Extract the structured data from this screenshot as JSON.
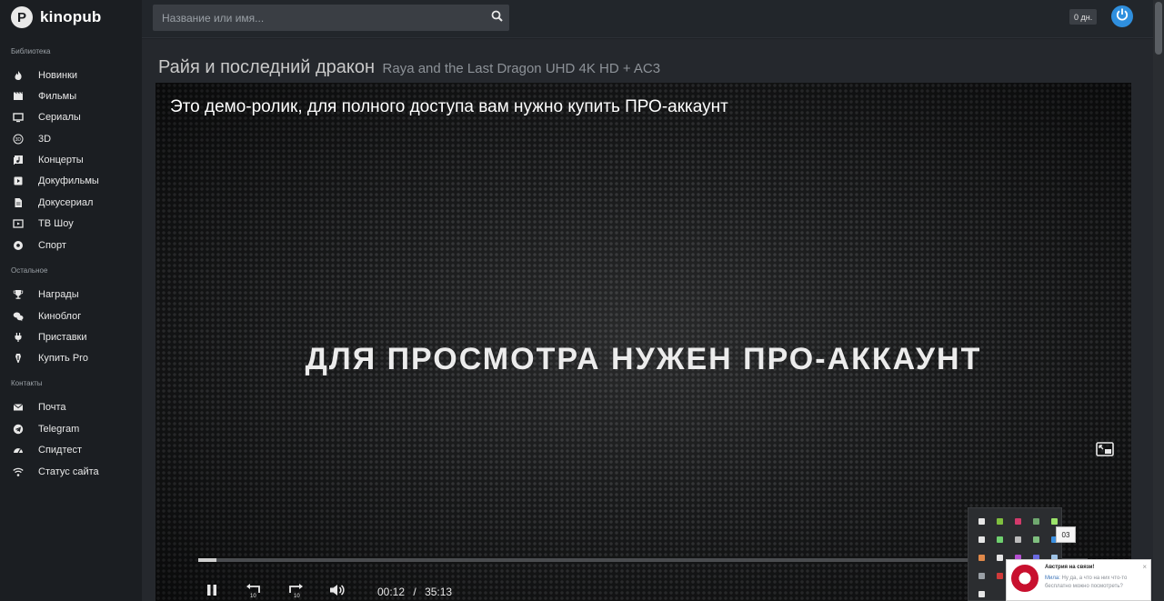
{
  "logo": {
    "text": "kinopub",
    "mark": "P"
  },
  "sidebar": {
    "sections": [
      {
        "title": "Библиотека",
        "items": [
          {
            "label": "Новинки",
            "icon": "fire-icon"
          },
          {
            "label": "Фильмы",
            "icon": "film-icon"
          },
          {
            "label": "Сериалы",
            "icon": "tv-icon"
          },
          {
            "label": "3D",
            "icon": "3d-icon"
          },
          {
            "label": "Концерты",
            "icon": "music-icon"
          },
          {
            "label": "Докуфильмы",
            "icon": "documentary-icon"
          },
          {
            "label": "Докусериал",
            "icon": "document-icon"
          },
          {
            "label": "ТВ Шоу",
            "icon": "tv-show-icon"
          },
          {
            "label": "Спорт",
            "icon": "soccer-ball-icon"
          }
        ]
      },
      {
        "title": "Остальное",
        "items": [
          {
            "label": "Награды",
            "icon": "trophy-icon"
          },
          {
            "label": "Киноблог",
            "icon": "chat-icon"
          },
          {
            "label": "Приставки",
            "icon": "plug-icon"
          },
          {
            "label": "Купить Pro",
            "icon": "pro-icon"
          }
        ]
      },
      {
        "title": "Контакты",
        "items": [
          {
            "label": "Почта",
            "icon": "mail-icon"
          },
          {
            "label": "Telegram",
            "icon": "telegram-icon"
          },
          {
            "label": "Спидтест",
            "icon": "speedometer-icon"
          },
          {
            "label": "Статус сайта",
            "icon": "wifi-icon"
          }
        ]
      }
    ]
  },
  "search": {
    "placeholder": "Название или имя..."
  },
  "header": {
    "days_badge": "0 дн."
  },
  "page": {
    "title_ru": "Райя и последний дракон",
    "title_en": "Raya and the Last Dragon UHD 4K HD + AC3"
  },
  "player": {
    "demo_notice": "Это демо-ролик, для полного доступа вам нужно купить ПРО-аккаунт",
    "overlay_text": "ДЛЯ ПРОСМОТРА НУЖЕН ПРО-АККАУНТ",
    "current_time": "00:12",
    "time_separator": "/",
    "duration": "35:13",
    "progress_fraction": 0.02
  },
  "tray": {
    "tooltip": "03"
  },
  "notification": {
    "title": "Австрия на связи!",
    "sender": "Мила:",
    "message": "Ну да, а что на них что-то бесплатно можно посмотреть?",
    "close": "×"
  },
  "colors": {
    "accent": "#2f8fde",
    "sidebar_bg": "#1b1e22",
    "content_bg": "#25282d"
  }
}
